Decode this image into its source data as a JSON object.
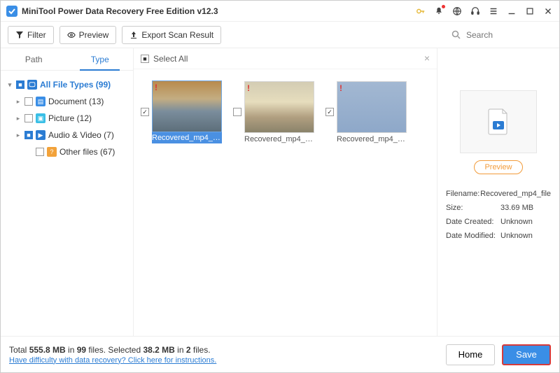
{
  "titlebar": {
    "title": "MiniTool Power Data Recovery Free Edition v12.3"
  },
  "toolbar": {
    "filter_label": "Filter",
    "preview_label": "Preview",
    "export_label": "Export Scan Result",
    "search_placeholder": "Search"
  },
  "sidebar": {
    "tabs": {
      "path": "Path",
      "type": "Type"
    },
    "tree": {
      "all": "All File Types (99)",
      "document": "Document (13)",
      "picture": "Picture (12)",
      "av": "Audio & Video (7)",
      "other": "Other files (67)"
    }
  },
  "center": {
    "select_all": "Select All",
    "files": [
      {
        "caption": "Recovered_mp4_fil...",
        "checked": true,
        "selected": true
      },
      {
        "caption": "Recovered_mp4_fil...",
        "checked": false,
        "selected": false
      },
      {
        "caption": "Recovered_mp4_fil...",
        "checked": true,
        "selected": false
      }
    ]
  },
  "right": {
    "preview_btn": "Preview",
    "labels": {
      "filename": "Filename:",
      "size": "Size:",
      "created": "Date Created:",
      "modified": "Date Modified:"
    },
    "values": {
      "filename": "Recovered_mp4_file",
      "size": "33.69 MB",
      "created": "Unknown",
      "modified": "Unknown"
    }
  },
  "footer": {
    "total_prefix": "Total ",
    "total_size": "555.8 MB",
    "total_mid": " in ",
    "total_files": "99",
    "total_suffix": " files.  Selected ",
    "sel_size": "38.2 MB",
    "sel_mid": " in ",
    "sel_files": "2",
    "sel_suffix": " files.",
    "help": "Have difficulty with data recovery? Click here for instructions.",
    "home": "Home",
    "save": "Save"
  }
}
